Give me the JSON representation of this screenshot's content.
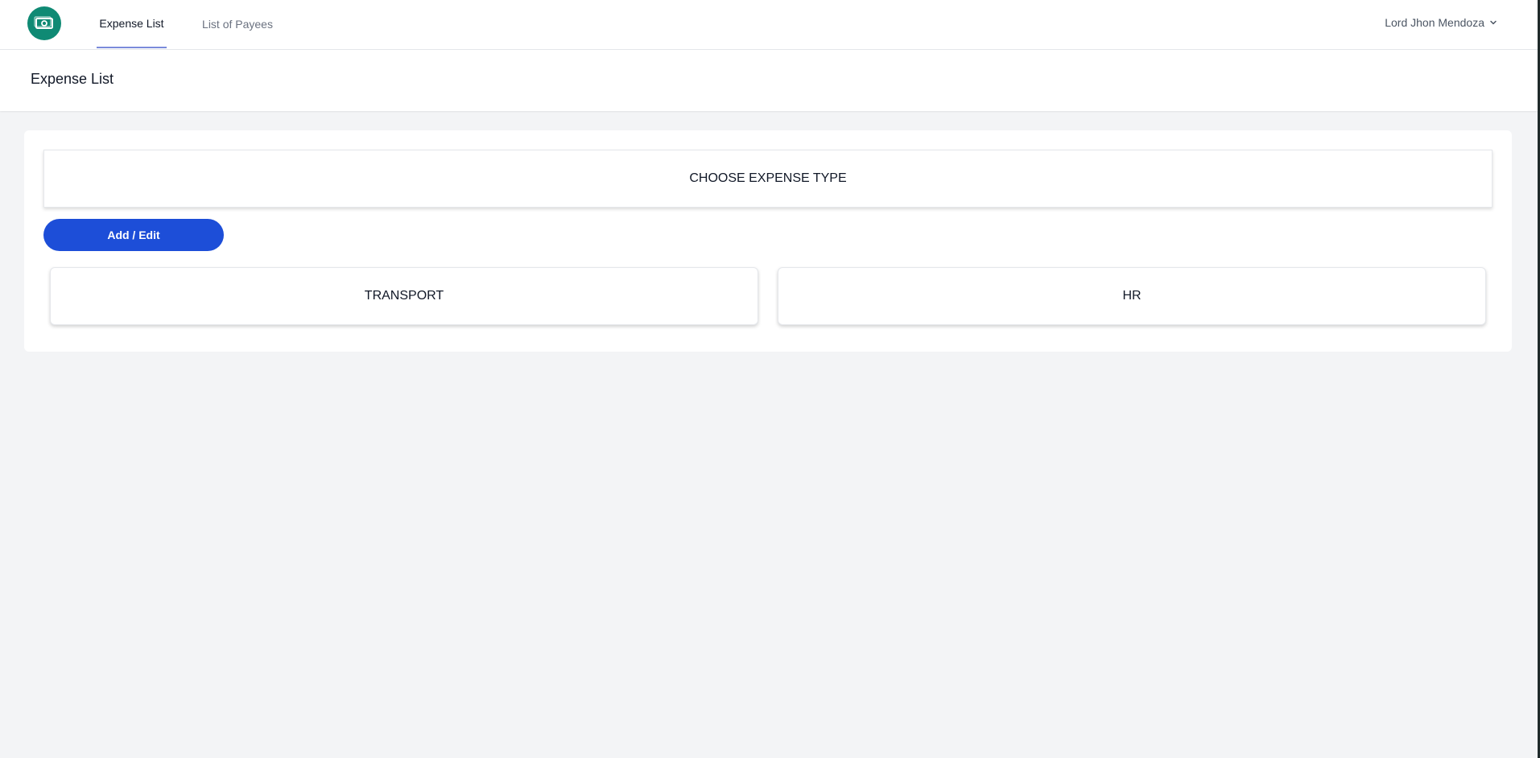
{
  "nav": {
    "logo_icon": "money-bill-icon",
    "tabs": [
      {
        "label": "Expense List",
        "active": true
      },
      {
        "label": "List of Payees",
        "active": false
      }
    ],
    "user_name": "Lord Jhon Mendoza",
    "user_menu_icon": "chevron-down-icon"
  },
  "header": {
    "title": "Expense List"
  },
  "main": {
    "choose_label": "CHOOSE EXPENSE TYPE",
    "add_button_label": "Add / Edit",
    "expense_types": [
      "TRANSPORT",
      "HR"
    ]
  },
  "colors": {
    "brand": "#0f8a74",
    "primary_button": "#1d4ed8",
    "active_tab_underline": "#7b8bdb",
    "page_background": "#f3f4f6"
  }
}
